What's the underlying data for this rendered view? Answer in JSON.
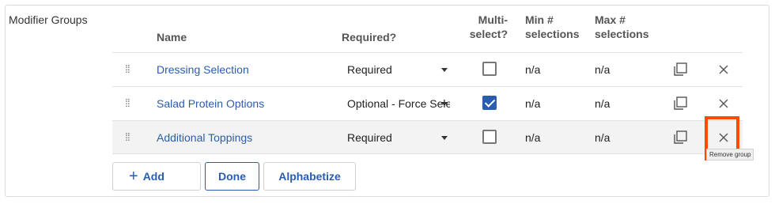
{
  "section": {
    "label": "Modifier Groups"
  },
  "columns": {
    "name": "Name",
    "required": "Required?",
    "multi": "Multi-\nselect?",
    "min": "Min #\nselections",
    "max": "Max #\nselections"
  },
  "rows": [
    {
      "name": "Dressing Selection",
      "required": "Required",
      "multi_select": false,
      "min": "n/a",
      "max": "n/a"
    },
    {
      "name": "Salad Protein Options",
      "required": "Optional - Force Selection",
      "multi_select": true,
      "min": "n/a",
      "max": "n/a"
    },
    {
      "name": "Additional Toppings",
      "required": "Required",
      "multi_select": false,
      "min": "n/a",
      "max": "n/a"
    }
  ],
  "tooltip": "Remove group",
  "buttons": {
    "add": "Add",
    "done": "Done",
    "alphabetize": "Alphabetize"
  },
  "icons": {
    "drag": "drag-handle-icon",
    "copy": "copy-icon",
    "remove": "close-icon",
    "add": "plus-icon",
    "caret": "caret-down-icon"
  },
  "colors": {
    "link": "#2a5db0",
    "highlight": "#ff4a00",
    "checkbox_checked": "#2a5db0"
  }
}
